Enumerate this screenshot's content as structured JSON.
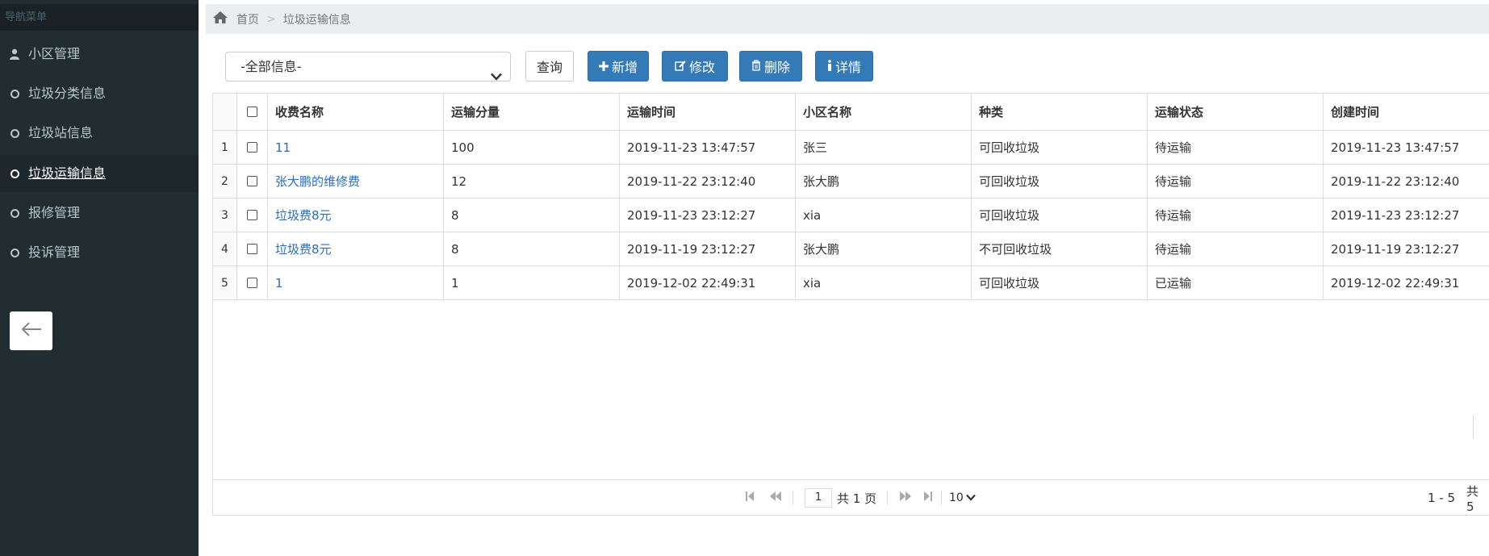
{
  "sidebar": {
    "header": "导航菜单",
    "items": [
      {
        "label": "小区管理",
        "icon": "user-icon",
        "active": false
      },
      {
        "label": "垃圾分类信息",
        "icon": "circle-icon",
        "active": false
      },
      {
        "label": "垃圾站信息",
        "icon": "circle-icon",
        "active": false
      },
      {
        "label": "垃圾运输信息",
        "icon": "circle-icon",
        "active": true
      },
      {
        "label": "报修管理",
        "icon": "circle-icon",
        "active": false
      },
      {
        "label": "投诉管理",
        "icon": "circle-icon",
        "active": false
      }
    ],
    "back_icon": "arrow-left-icon"
  },
  "breadcrumb": {
    "home_icon": "home-icon",
    "home": "首页",
    "separator": ">",
    "current": "垃圾运输信息"
  },
  "toolbar": {
    "filter_value": "-全部信息-",
    "query_label": "查询",
    "add_label": "新增",
    "edit_label": "修改",
    "delete_label": "删除",
    "detail_label": "详情"
  },
  "table": {
    "columns": [
      "收费名称",
      "运输分量",
      "运输时间",
      "小区名称",
      "种类",
      "运输状态",
      "创建时间"
    ],
    "rows": [
      {
        "index": "1",
        "name": "11",
        "amount": "100",
        "time": "2019-11-23 13:47:57",
        "community": "张三",
        "kind": "可回收垃圾",
        "status": "待运输",
        "created": "2019-11-23 13:47:57"
      },
      {
        "index": "2",
        "name": "张大鹏的维修费",
        "amount": "12",
        "time": "2019-11-22 23:12:40",
        "community": "张大鹏",
        "kind": "可回收垃圾",
        "status": "待运输",
        "created": "2019-11-22 23:12:40"
      },
      {
        "index": "3",
        "name": "垃圾费8元",
        "amount": "8",
        "time": "2019-11-23 23:12:27",
        "community": "xia",
        "kind": "可回收垃圾",
        "status": "待运输",
        "created": "2019-11-23 23:12:27"
      },
      {
        "index": "4",
        "name": "垃圾费8元",
        "amount": "8",
        "time": "2019-11-19 23:12:27",
        "community": "张大鹏",
        "kind": "不可回收垃圾",
        "status": "待运输",
        "created": "2019-11-19 23:12:27"
      },
      {
        "index": "5",
        "name": "1",
        "amount": "1",
        "time": "2019-12-02 22:49:31",
        "community": "xia",
        "kind": "可回收垃圾",
        "status": "已运输",
        "created": "2019-12-02 22:49:31"
      }
    ]
  },
  "pager": {
    "page": "1",
    "total_pages_text": "共 1 页",
    "page_size": "10",
    "range_text": "1 - 5",
    "total_text": "共 5"
  },
  "colors": {
    "sidebar_bg": "#222d32",
    "primary": "#337ab7",
    "link": "#2a6ebb"
  }
}
